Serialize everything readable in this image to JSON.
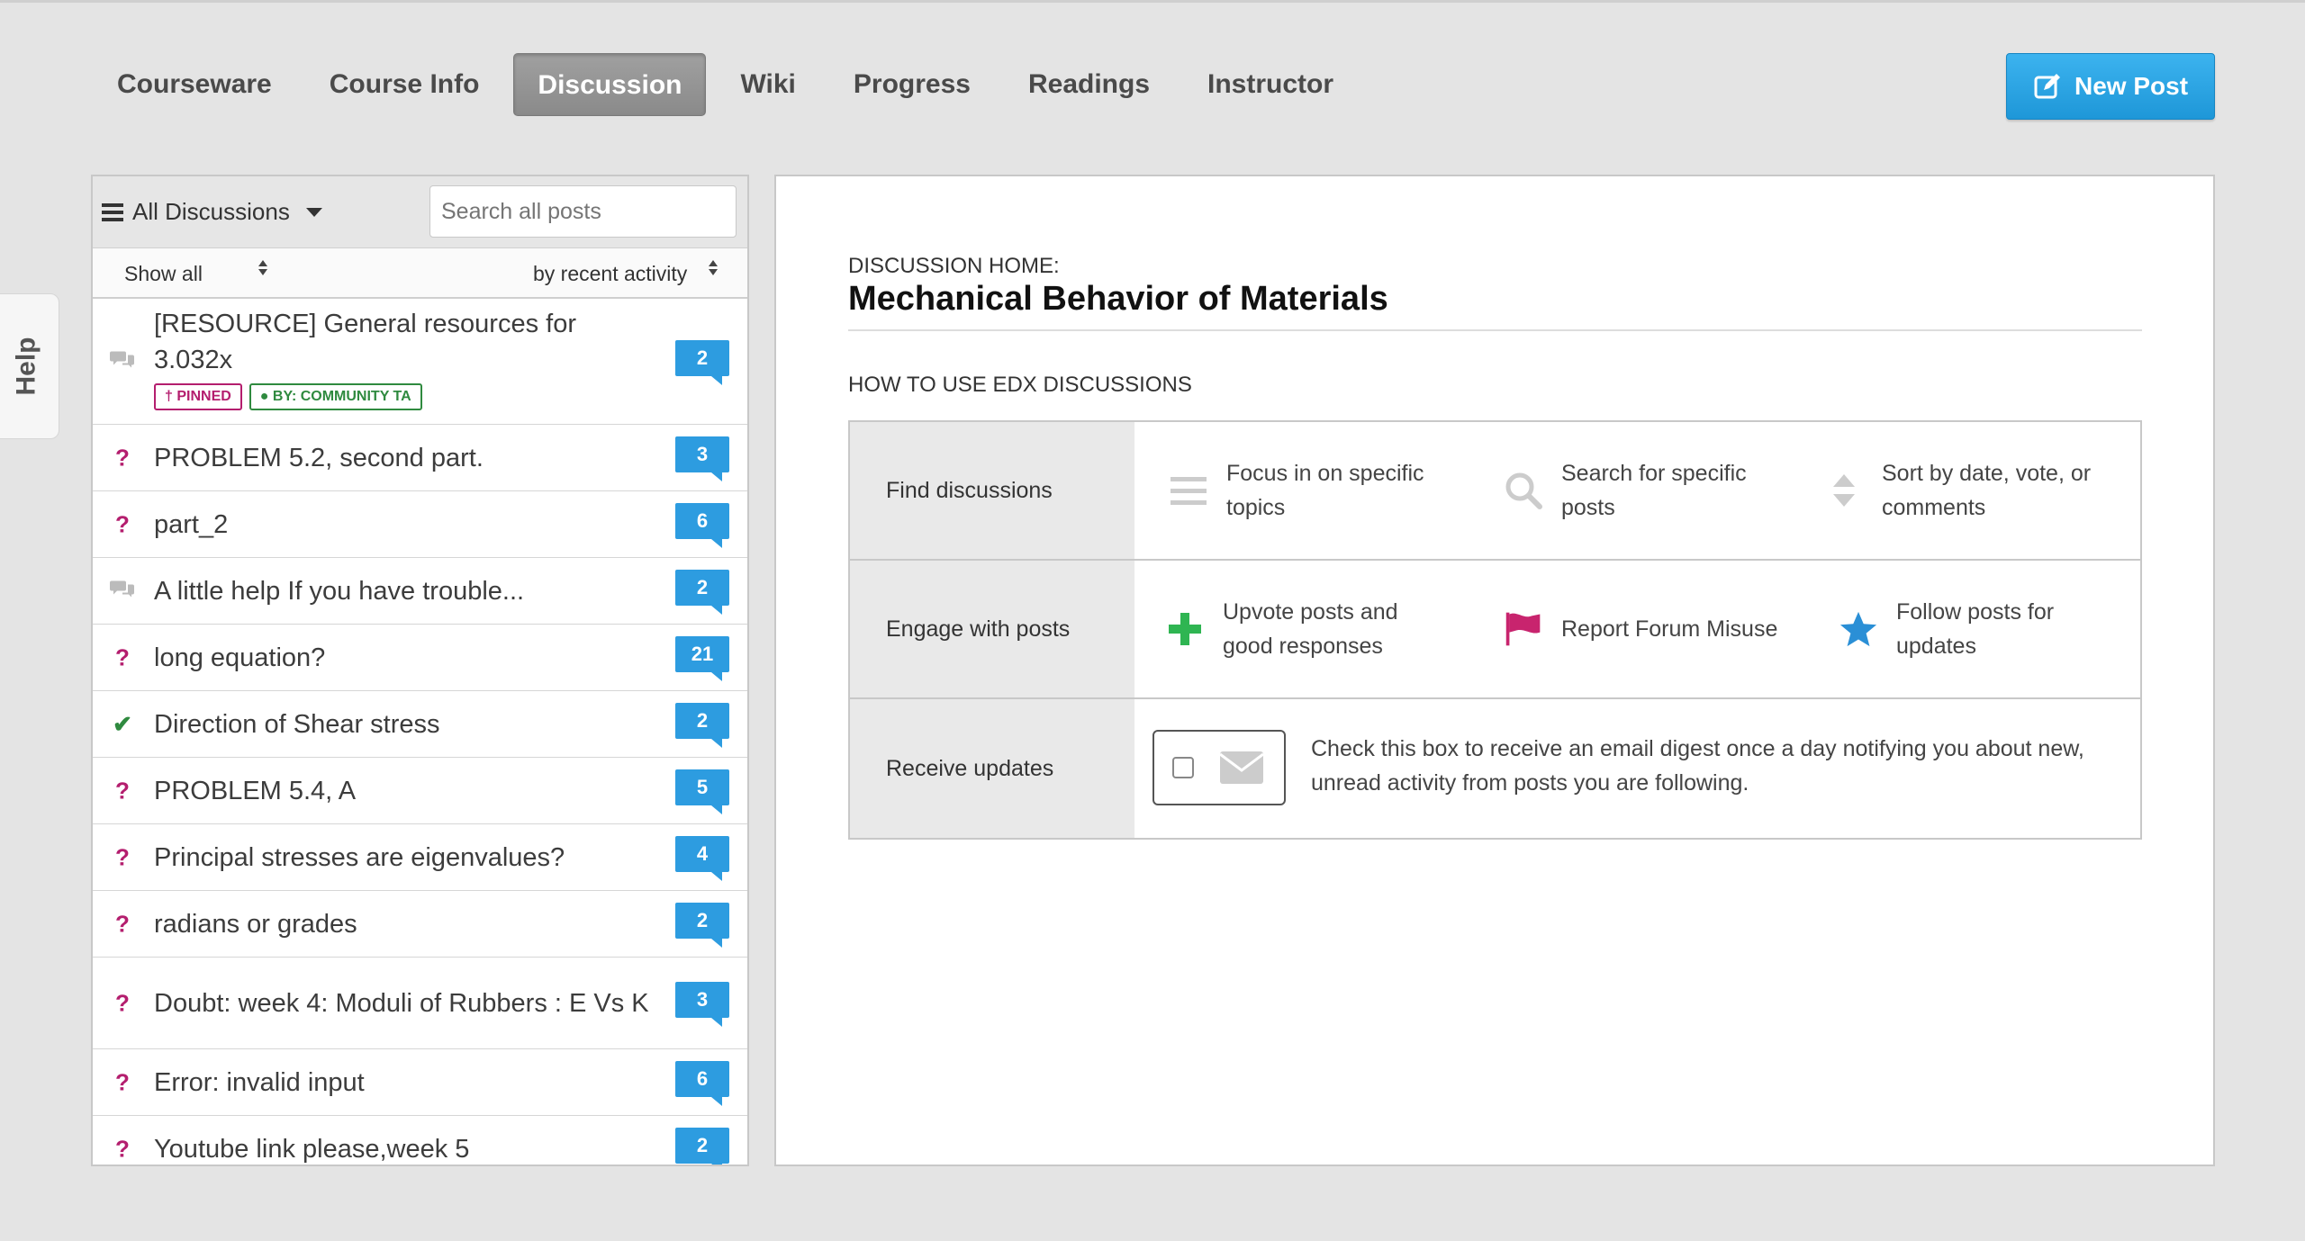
{
  "nav": {
    "tabs": [
      {
        "label": "Courseware"
      },
      {
        "label": "Course Info"
      },
      {
        "label": "Discussion"
      },
      {
        "label": "Wiki"
      },
      {
        "label": "Progress"
      },
      {
        "label": "Readings"
      },
      {
        "label": "Instructor"
      }
    ],
    "active_tab": "Discussion",
    "new_post_label": "New Post"
  },
  "help_tab": "Help",
  "sidebar": {
    "menu_label": "All Discussions",
    "search_placeholder": "Search all posts",
    "filter_label": "Show all",
    "sort_label": "by recent activity",
    "threads": [
      {
        "type": "discussion",
        "title": "[RESOURCE] General resources for 3.032x",
        "count": "2",
        "pinned": "PINNED",
        "author_label": "BY: COMMUNITY TA"
      },
      {
        "type": "question",
        "title": "PROBLEM 5.2, second part.",
        "count": "3"
      },
      {
        "type": "question",
        "title": "part_2",
        "count": "6"
      },
      {
        "type": "discussion",
        "title": "A little help If you have trouble...",
        "count": "2"
      },
      {
        "type": "question",
        "title": "long equation?",
        "count": "21"
      },
      {
        "type": "answered",
        "title": "Direction of Shear stress",
        "count": "2"
      },
      {
        "type": "question",
        "title": "PROBLEM 5.4, A",
        "count": "5"
      },
      {
        "type": "question",
        "title": "Principal stresses are eigenvalues?",
        "count": "4"
      },
      {
        "type": "question",
        "title": "radians or grades",
        "count": "2"
      },
      {
        "type": "question",
        "title": "Doubt: week 4: Moduli of Rubbers : E Vs K",
        "count": "3"
      },
      {
        "type": "question",
        "title": "Error: invalid input",
        "count": "6"
      },
      {
        "type": "question",
        "title": "Youtube link please,week 5",
        "count": "2"
      }
    ]
  },
  "main": {
    "home_label": "DISCUSSION HOME:",
    "course_title": "Mechanical Behavior of Materials",
    "howto_heading": "HOW TO USE EDX DISCUSSIONS",
    "rows": [
      {
        "label": "Find discussions",
        "items": [
          {
            "icon": "list-icon",
            "text_line1": "Focus in on specific",
            "text_line2": "topics"
          },
          {
            "icon": "search-icon",
            "text_line1": "Search for specific",
            "text_line2": "posts"
          },
          {
            "icon": "sort-icon",
            "text_line1": "Sort by date, vote, or",
            "text_line2": "comments"
          }
        ]
      },
      {
        "label": "Engage with posts",
        "items": [
          {
            "icon": "plus-icon",
            "text_line1": "Upvote posts and",
            "text_line2": "good responses"
          },
          {
            "icon": "flag-icon",
            "text_line1": "Report Forum Misuse",
            "text_line2": ""
          },
          {
            "icon": "star-icon",
            "text_line1": "Follow posts for",
            "text_line2": "updates"
          }
        ]
      },
      {
        "label": "Receive updates",
        "email_text": "Check this box to receive an email digest once a day notifying you about new, unread activity from posts you are following."
      }
    ]
  },
  "colors": {
    "accent_blue": "#2d9ce0",
    "question_magenta": "#b41e6e",
    "answered_green": "#2f8a3f",
    "plus_green": "#2fb552",
    "flag_pink": "#c8246e",
    "star_blue": "#2a8fd6"
  }
}
